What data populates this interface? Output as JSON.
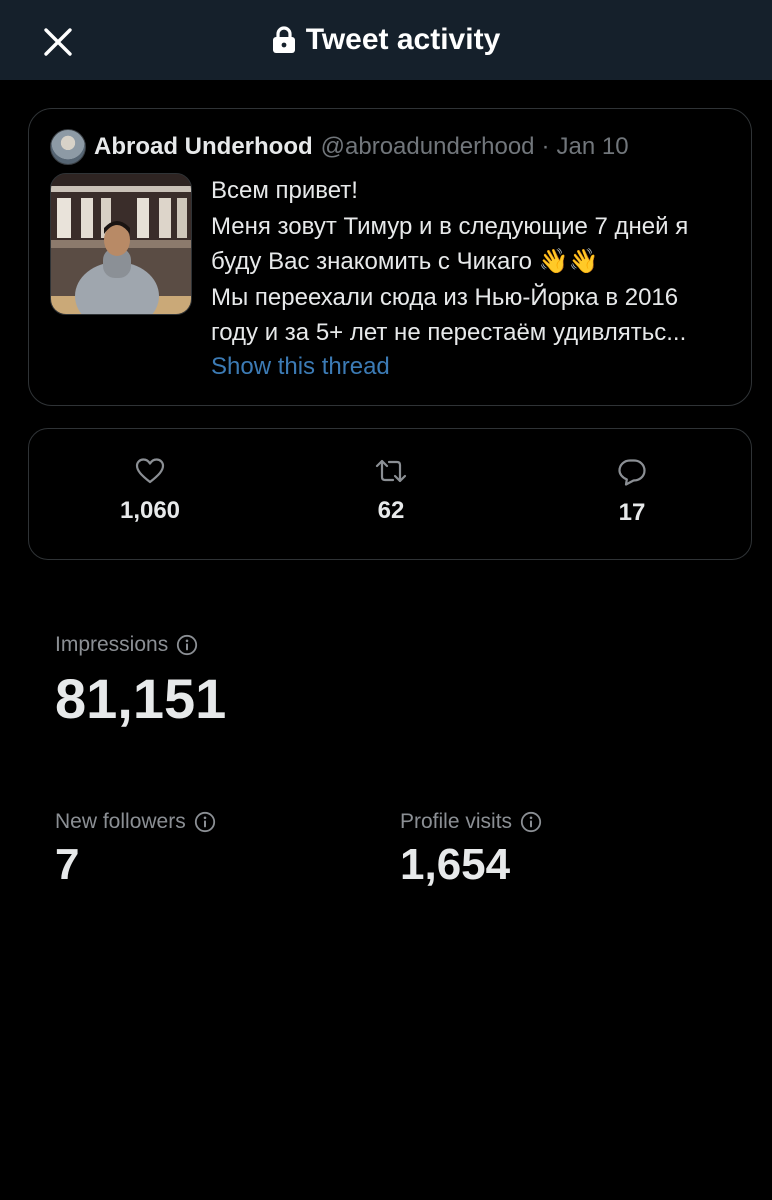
{
  "header": {
    "title": "Tweet activity"
  },
  "tweet": {
    "author_name": "Abroad Underhood",
    "author_handle": "@abroadunderhood",
    "separator": "·",
    "date": "Jan 10",
    "lines": [
      "Всем привет!",
      "Меня зовут Тимур и в следующие 7 дней я",
      "буду Вас знакомить с Чикаго 👋👋",
      "Мы переехали сюда из Нью-Йорка в 2016",
      "году и за 5+ лет не перестаём удивлятьс..."
    ],
    "show_thread": "Show this thread"
  },
  "engagement": {
    "likes": "1,060",
    "retweets": "62",
    "replies": "17"
  },
  "metrics": {
    "impressions": {
      "label": "Impressions",
      "value": "81,151"
    },
    "new_followers": {
      "label": "New followers",
      "value": "7"
    },
    "profile_visits": {
      "label": "Profile visits",
      "value": "1,654"
    }
  },
  "icons": {
    "close": "close-icon",
    "lock": "lock-icon",
    "like": "heart-icon",
    "retweet": "retweet-icon",
    "reply": "reply-icon",
    "info": "info-icon"
  },
  "colors": {
    "header_bg": "#15202b",
    "background": "#000000",
    "border": "#2f3336",
    "link": "#3c7bb5",
    "muted": "#71767b",
    "text": "#e7e9ea"
  }
}
